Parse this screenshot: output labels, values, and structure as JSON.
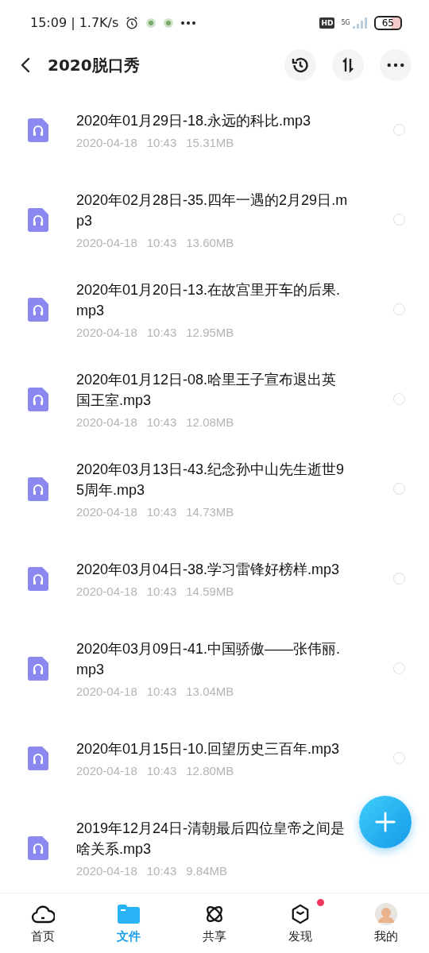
{
  "status_bar": {
    "time": "15:09 | 1.7K/s",
    "hd": "HD",
    "network": "5G",
    "battery": "65"
  },
  "header": {
    "title": "2020脱口秀"
  },
  "files": [
    {
      "name": "2020年01月29日-18.永远的科比.mp3",
      "date": "2020-04-18",
      "time": "10:43",
      "size": "15.31MB",
      "selected": false
    },
    {
      "name": "2020年02月28日-35.四年一遇的2月29日.mp3",
      "date": "2020-04-18",
      "time": "10:43",
      "size": "13.60MB",
      "selected": false
    },
    {
      "name": "2020年01月20日-13.在故宫里开车的后果.mp3",
      "date": "2020-04-18",
      "time": "10:43",
      "size": "12.95MB",
      "selected": false
    },
    {
      "name": "2020年01月12日-08.哈里王子宣布退出英国王室.mp3",
      "date": "2020-04-18",
      "time": "10:43",
      "size": "12.08MB",
      "selected": false
    },
    {
      "name": "2020年03月13日-43.纪念孙中山先生逝世95周年.mp3",
      "date": "2020-04-18",
      "time": "10:43",
      "size": "14.73MB",
      "selected": false
    },
    {
      "name": "2020年03月04日-38.学习雷锋好榜样.mp3",
      "date": "2020-04-18",
      "time": "10:43",
      "size": "14.59MB",
      "selected": false
    },
    {
      "name": "2020年03月09日-41.中国骄傲——张伟丽.mp3",
      "date": "2020-04-18",
      "time": "10:43",
      "size": "13.04MB",
      "selected": false
    },
    {
      "name": "2020年01月15日-10.回望历史三百年.mp3",
      "date": "2020-04-18",
      "time": "10:43",
      "size": "12.80MB",
      "selected": false
    },
    {
      "name": "2019年12月24日-清朝最后四位皇帝之间是啥关系.mp3",
      "date": "2020-04-18",
      "time": "10:43",
      "size": "9.84MB"
    }
  ],
  "tabs": [
    {
      "kind": "home",
      "label": "首页",
      "selected": false,
      "badge": false
    },
    {
      "kind": "files",
      "label": "文件",
      "selected": true,
      "badge": false
    },
    {
      "kind": "share",
      "label": "共享",
      "selected": false,
      "badge": false
    },
    {
      "kind": "discover",
      "label": "发现",
      "selected": false,
      "badge": true
    },
    {
      "kind": "me",
      "label": "我的",
      "selected": false,
      "badge": false
    }
  ]
}
